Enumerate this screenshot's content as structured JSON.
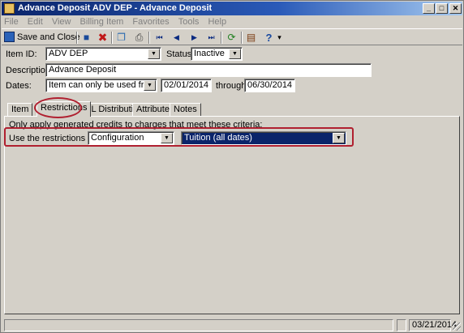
{
  "window": {
    "title": "Advance Deposit ADV DEP - Advance Deposit",
    "min_glyph": "_",
    "max_glyph": "□",
    "close_glyph": "✕"
  },
  "menu": [
    "File",
    "Edit",
    "View",
    "Billing Item",
    "Favorites",
    "Tools",
    "Help"
  ],
  "toolbar": {
    "save_close_label": "Save and Close",
    "dropdown_glyph": "▾",
    "icons": [
      "save-icon",
      "delete-icon",
      "copy-icon",
      "print-icon",
      "first-record-icon",
      "previous-record-icon",
      "next-record-icon",
      "last-record-icon",
      "refresh-icon",
      "properties-icon",
      "help-icon"
    ],
    "glyphs": {
      "save": "■",
      "delete": "✖",
      "copy": "❐",
      "print": "⎙",
      "first": "⏮",
      "previous": "◀",
      "next": "▶",
      "last": "⏭",
      "refresh": "⟳",
      "properties": "▤",
      "help": "?"
    }
  },
  "form": {
    "item_id_label": "Item ID:",
    "item_id_value": "ADV DEP",
    "status_label": "Status:",
    "status_value": "Inactive",
    "description_label": "Description:",
    "description_value": "Advance Deposit",
    "dates_label": "Dates:",
    "dates_mode_value": "Item can only be used from",
    "date_from": "02/01/2014",
    "through_label": "through",
    "date_to": "06/30/2014"
  },
  "tabs": [
    "Item",
    "Restrictions",
    "GL Distribution",
    "Attributes",
    "Notes"
  ],
  "selected_tab": "Restrictions",
  "restrictions": {
    "instruction": "Only apply generated credits to charges that meet these criteria:",
    "use_label": "Use the restrictions from:",
    "source_value": "Configuration",
    "criteria_value": "Tuition (all dates)"
  },
  "statusbar": {
    "date": "03/21/2014"
  },
  "colors": {
    "title_bar": "#0a246a",
    "highlight": "#b02030",
    "selected_field": "#0a246a"
  }
}
